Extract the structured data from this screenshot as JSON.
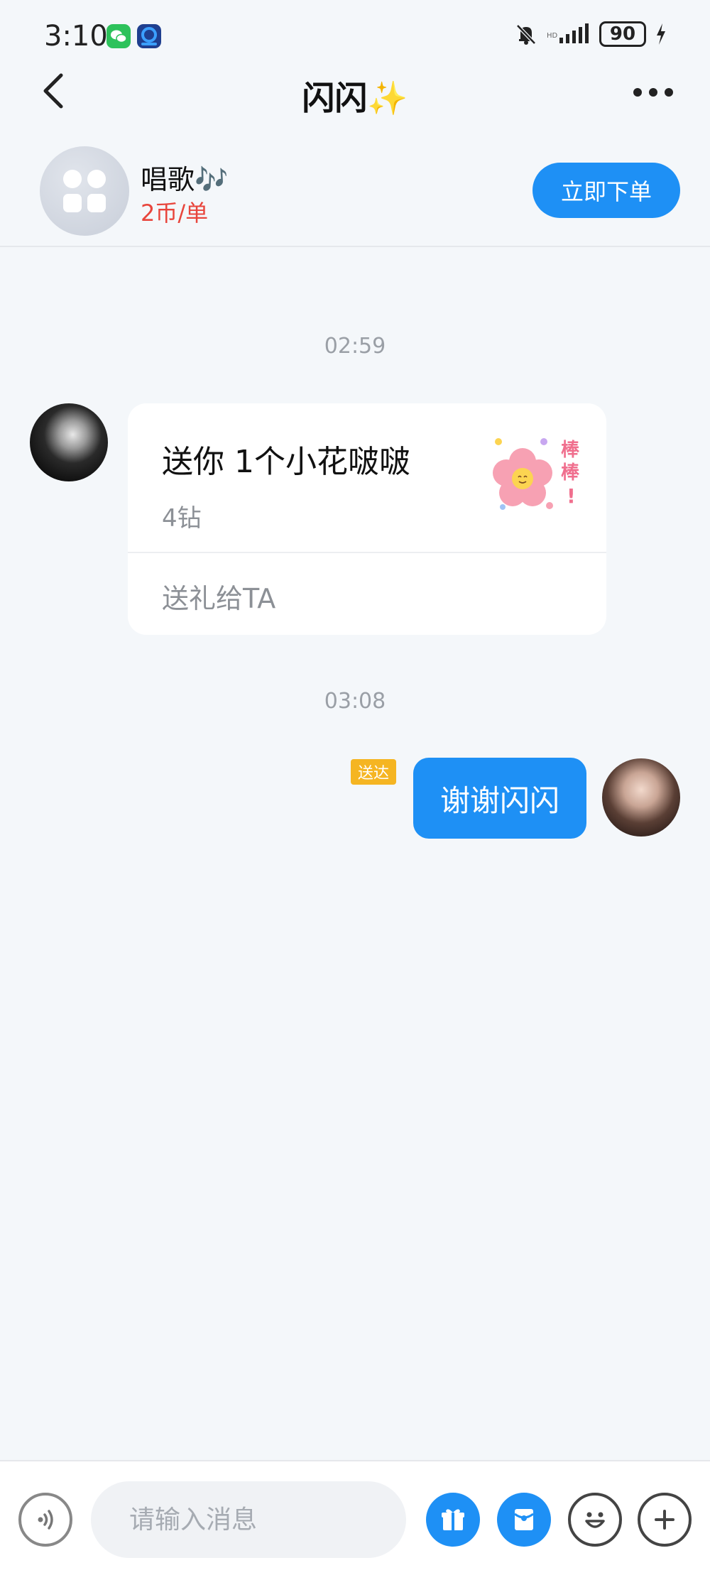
{
  "status_bar": {
    "time": "3:10",
    "battery": "90"
  },
  "header": {
    "title": "闪闪✨"
  },
  "service": {
    "name": "唱歌🎶",
    "price": "2币/单",
    "order_label": "立即下单"
  },
  "messages": {
    "time_1": "02:59",
    "gift_card": {
      "title": "送你 1个小花啵啵",
      "price": "4钻",
      "action": "送礼给TA"
    },
    "time_2": "03:08",
    "sent": {
      "text": "谢谢闪闪",
      "status": "送达"
    }
  },
  "input_bar": {
    "placeholder": "请输入消息"
  },
  "colors": {
    "accent": "#1e90f5",
    "price_red": "#e8453c",
    "delivered_badge": "#f5b522",
    "background": "#f4f7fa"
  },
  "icons": {
    "back": "chevron-left-icon",
    "more": "more-dots-icon",
    "voice": "voice-icon",
    "gift": "gift-icon",
    "red_packet": "red-packet-icon",
    "emoji": "emoji-icon",
    "plus": "plus-icon"
  }
}
